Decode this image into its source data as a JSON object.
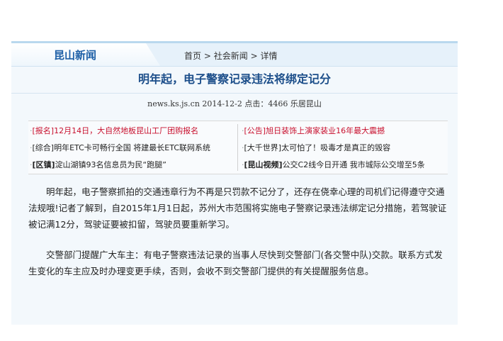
{
  "header": {
    "section_title": "昆山新闻",
    "breadcrumb": {
      "home": "首页",
      "sep1": ">",
      "category": "社会新闻",
      "sep2": ">",
      "current": "详情"
    }
  },
  "article": {
    "title": "明年起，电子警察记录违法将绑定记分",
    "meta": "news.ks.js.cn 2014-12-2 点击：4466 乐居昆山",
    "paragraphs": [
      "明年起，电子警察抓拍的交通违章行为不再是只罚款不记分了，还存在侥幸心理的司机们记得遵守交通法规哦!记者了解到，自2015年1月1日起，苏州大市范围将实施电子警察记录违法绑定记分措施，若驾驶证被记满12分，驾驶证要被扣留，驾驶员要重新学习。",
      "交警部门提醒广大车主：有电子警察违法记录的当事人尽快到交警部门(各交警中队)交款。联系方式发生变化的车主应及时办理变更手续，否则，会收不到交警部门提供的有关提醒服务信息。"
    ]
  },
  "related": {
    "left": [
      {
        "tag": "[报名]",
        "text": "12月14日，大自然地板昆山工厂团购报名"
      },
      {
        "tag": "[综合]",
        "text": "明年ETC卡可畅行全国 将建最长ETC联网系统"
      },
      {
        "tag": "[区镇]",
        "text": "淀山湖镇93名信息员为民“跑腿”"
      }
    ],
    "right": [
      {
        "tag": "[公告]",
        "text": "旭日装饰上演家装业16年最大震撼"
      },
      {
        "tag": "[大千世界]",
        "text": "太可怕了！吸毒才是真正的毁容"
      },
      {
        "tag": "[昆山视频]",
        "text": "公交C2线今日开通 我市城际公交增至5条"
      }
    ]
  },
  "colors": {
    "title_blue": "#1c4e8a",
    "section_blue": "#1d5fa6",
    "accent_red": "#c8102e"
  }
}
